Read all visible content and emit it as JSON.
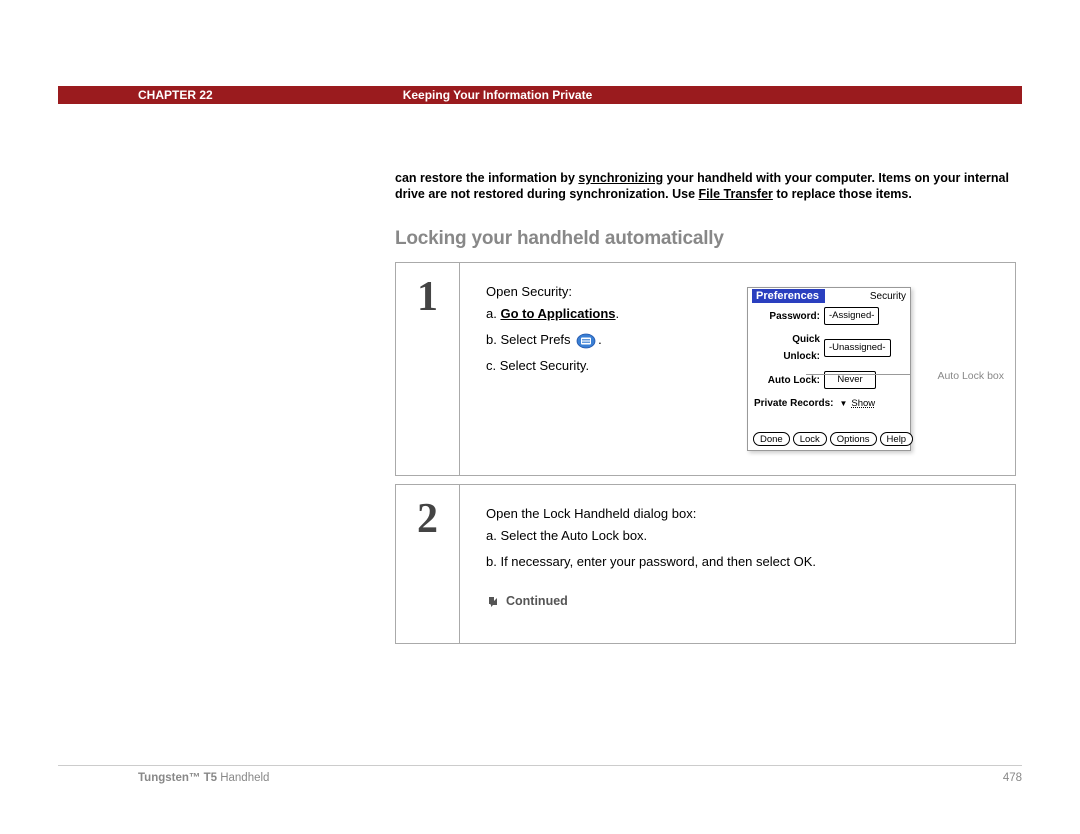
{
  "header": {
    "chapter_label": "CHAPTER 22",
    "chapter_title": "Keeping Your Information Private"
  },
  "intro": {
    "part1": "can restore the information by ",
    "link1": "synchronizing",
    "part2": " your handheld with your computer. Items on your internal drive are not restored during synchronization. Use ",
    "link2": "File Transfer",
    "part3": " to replace those items."
  },
  "section_heading": "Locking your handheld automatically",
  "step1": {
    "number": "1",
    "title": "Open Security:",
    "a_prefix": "a.  ",
    "a_link": "Go to Applications",
    "a_suffix": ".",
    "b_prefix": "b.  Select Prefs ",
    "b_suffix": ".",
    "c_text": "c.  Select Security.",
    "callout": "Auto Lock box"
  },
  "palm": {
    "title_left": "Preferences",
    "title_right": "Security",
    "rows": {
      "password_label": "Password:",
      "password_value": "-Assigned-",
      "quick_unlock_label": "Quick Unlock:",
      "quick_unlock_value": "-Unassigned-",
      "auto_lock_label": "Auto Lock:",
      "auto_lock_value": "Never",
      "private_label": "Private Records:",
      "private_value": "Show"
    },
    "buttons": {
      "done": "Done",
      "lock": "Lock",
      "options": "Options",
      "help": "Help"
    }
  },
  "step2": {
    "number": "2",
    "title": "Open the Lock Handheld dialog box:",
    "a_text": "a.  Select the Auto Lock box.",
    "b_text": "b.  If necessary, enter your password, and then select OK.",
    "continued": "Continued"
  },
  "footer": {
    "product_bold": "Tungsten™ T5",
    "product_rest": " Handheld",
    "page": "478"
  }
}
